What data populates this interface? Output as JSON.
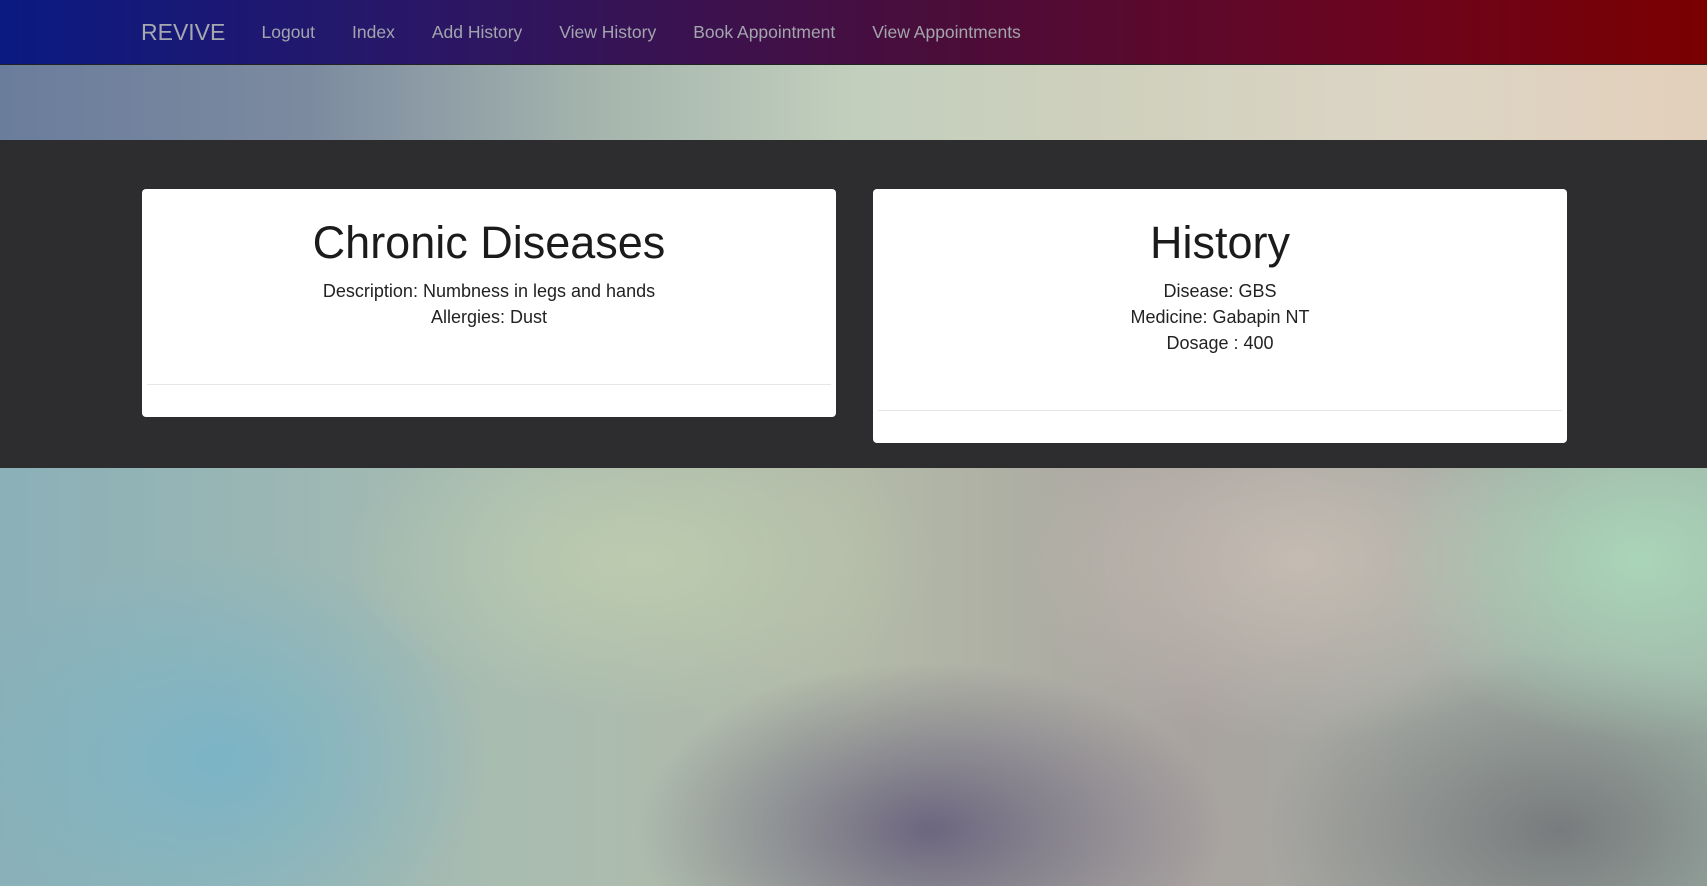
{
  "navbar": {
    "brand": "REVIVE",
    "items": [
      {
        "label": "Logout"
      },
      {
        "label": "Index"
      },
      {
        "label": "Add History"
      },
      {
        "label": "View History"
      },
      {
        "label": "Book Appointment"
      },
      {
        "label": "View Appointments"
      }
    ]
  },
  "cards": {
    "chronic": {
      "title": "Chronic Diseases",
      "description": "Description: Numbness in legs and hands",
      "allergies": "Allergies: Dust"
    },
    "history": {
      "title": "History",
      "disease": "Disease: GBS",
      "medicine": "Medicine: Gabapin NT",
      "dosage": "Dosage : 400"
    }
  },
  "colors": {
    "navbar_start": "#0a1a82",
    "navbar_end": "#7a0000",
    "band": "#2d2d30",
    "card_bg": "#ffffff"
  }
}
